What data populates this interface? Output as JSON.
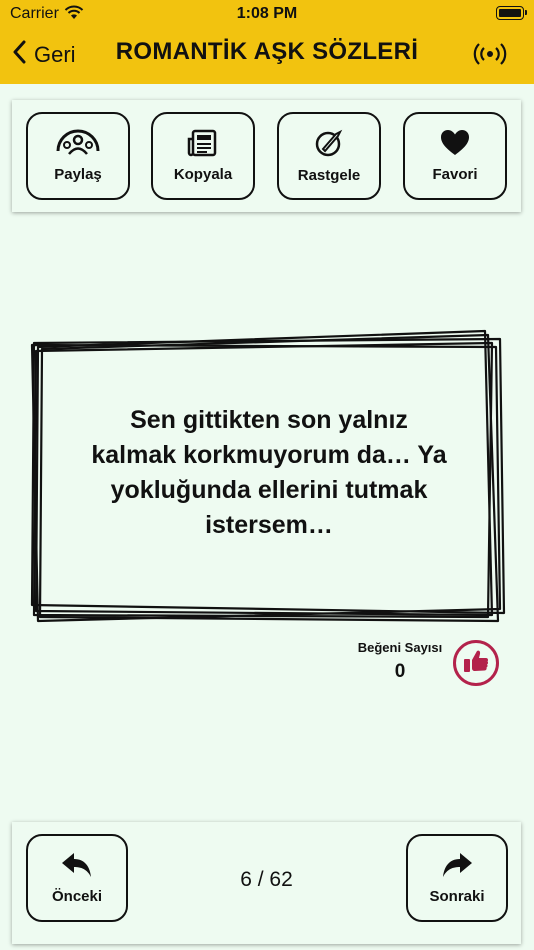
{
  "status_bar": {
    "carrier": "Carrier",
    "time": "1:08 PM"
  },
  "header": {
    "back_label": "Geri",
    "title": "ROMANTİK AŞK SÖZLERİ",
    "broadcast_icon": "broadcast-icon"
  },
  "toolbar": {
    "share_label": "Paylaş",
    "copy_label": "Kopyala",
    "random_label": "Rastgele",
    "favorite_label": "Favori"
  },
  "quote": {
    "text": "Sen gittikten son yalnız kalmak korkmuyorum da… Ya yokluğunda ellerini tutmak istersem…"
  },
  "likes": {
    "label": "Beğeni Sayısı",
    "count": "0",
    "accent": "#b3224b"
  },
  "pager": {
    "previous_label": "Önceki",
    "next_label": "Sonraki",
    "position": "6 / 62"
  },
  "colors": {
    "nav_bg": "#f2c30f",
    "page_bg": "#eefbf1",
    "like_accent": "#b3224b"
  }
}
